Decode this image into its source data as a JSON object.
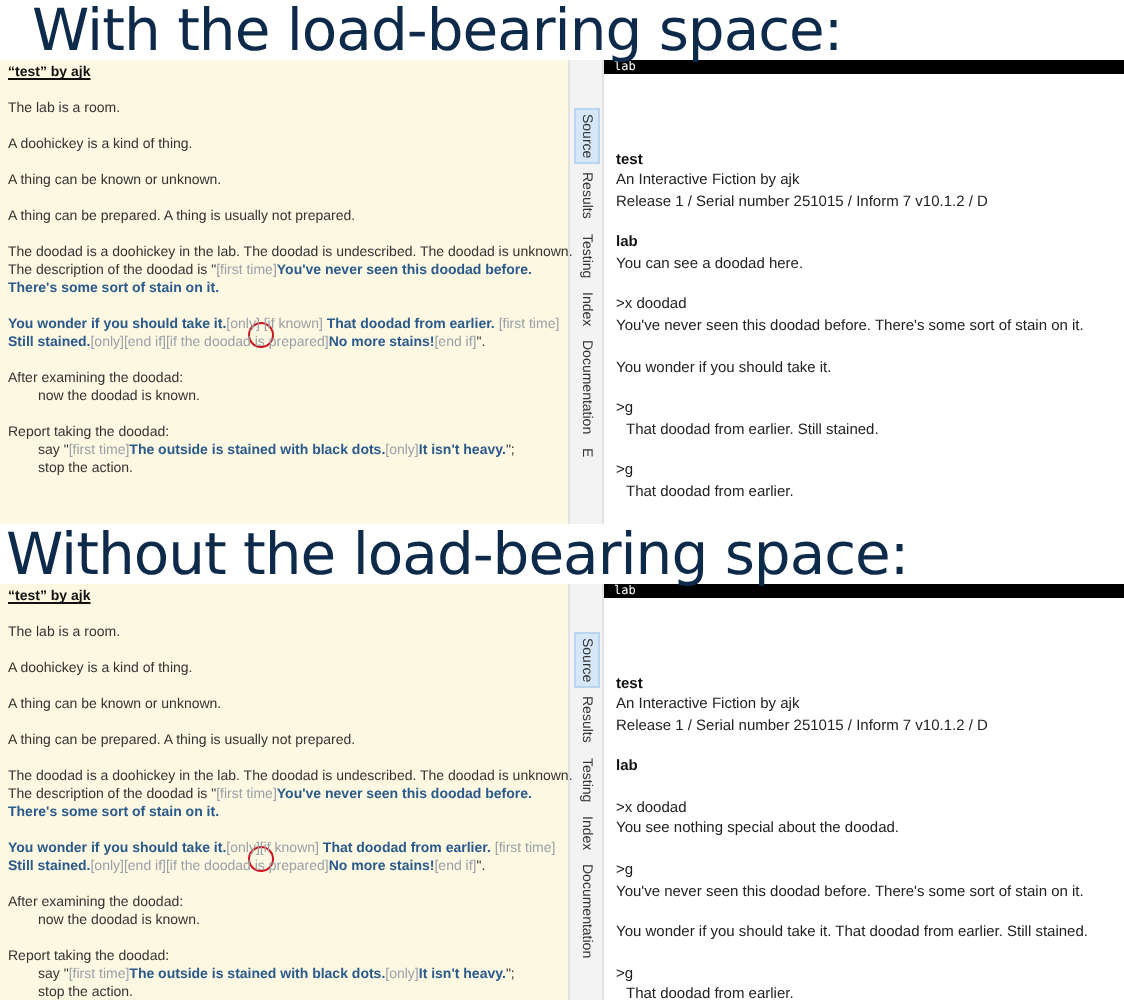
{
  "panels": [
    {
      "heading": "With the load-bearing space:",
      "source": {
        "title": "“test” by ajk",
        "paragraphs": [
          [
            {
              "segments": [
                {
                  "text": "The lab is a room.",
                  "kind": "plain"
                }
              ]
            }
          ],
          [
            {
              "segments": [
                {
                  "text": "A doohickey is a kind of thing.",
                  "kind": "plain"
                }
              ]
            }
          ],
          [
            {
              "segments": [
                {
                  "text": "A thing can be known or unknown.",
                  "kind": "plain"
                }
              ]
            }
          ],
          [
            {
              "segments": [
                {
                  "text": "A thing can be prepared. A thing is usually not prepared.",
                  "kind": "plain"
                }
              ]
            }
          ],
          [
            {
              "segments": [
                {
                  "text": "The doodad is a doohickey in the lab.  The doodad is undescribed. The doodad is unknown.",
                  "kind": "plain"
                }
              ]
            },
            {
              "segments": [
                {
                  "text": "The description of the doodad is \"",
                  "kind": "plain"
                },
                {
                  "text": "[first time]",
                  "kind": "comment"
                },
                {
                  "text": "You've never seen this doodad before.",
                  "kind": "quoted"
                }
              ]
            },
            {
              "segments": [
                {
                  "text": "There's some sort of stain on it.",
                  "kind": "quoted"
                }
              ]
            }
          ],
          [
            {
              "segments": [
                {
                  "text": "You wonder if you should take it.",
                  "kind": "quoted"
                },
                {
                  "text": "[only]",
                  "kind": "comment"
                },
                {
                  "text": " [if known]",
                  "kind": "comment",
                  "circled": true
                },
                {
                  "text": " That doodad from earlier.",
                  "kind": "quoted"
                },
                {
                  "text": " [first time]",
                  "kind": "comment"
                }
              ]
            },
            {
              "segments": [
                {
                  "text": "Still stained.",
                  "kind": "quoted"
                },
                {
                  "text": "[only][end if][if the doodad is prepared]",
                  "kind": "comment"
                },
                {
                  "text": "No more stains!",
                  "kind": "quoted"
                },
                {
                  "text": "[end if]",
                  "kind": "comment"
                },
                {
                  "text": "\".",
                  "kind": "plain"
                }
              ]
            }
          ],
          [
            {
              "segments": [
                {
                  "text": "After examining the doodad:",
                  "kind": "plain"
                }
              ],
              "children": [
                {
                  "segments": [
                    {
                      "text": "now the doodad is known.",
                      "kind": "plain"
                    }
                  ]
                }
              ]
            }
          ],
          [
            {
              "segments": [
                {
                  "text": "Report taking the doodad:",
                  "kind": "plain"
                }
              ],
              "children": [
                {
                  "segments": [
                    {
                      "text": "say \"",
                      "kind": "plain"
                    },
                    {
                      "text": "[first time]",
                      "kind": "comment"
                    },
                    {
                      "text": "The outside is stained with black dots.",
                      "kind": "quoted"
                    },
                    {
                      "text": "[only]",
                      "kind": "comment"
                    },
                    {
                      "text": "It isn't heavy.",
                      "kind": "quoted"
                    },
                    {
                      "text": "\";",
                      "kind": "plain"
                    }
                  ]
                },
                {
                  "segments": [
                    {
                      "text": "stop the action.",
                      "kind": "plain"
                    }
                  ]
                }
              ]
            }
          ]
        ]
      },
      "tabs": [
        {
          "label": "Source",
          "selected": true
        },
        {
          "label": "Results",
          "selected": false
        },
        {
          "label": "Testing",
          "selected": false
        },
        {
          "label": "Index",
          "selected": false
        },
        {
          "label": "Documentation",
          "selected": false
        },
        {
          "label": "E",
          "selected": false
        }
      ],
      "status_bar": "lab",
      "story": [
        [
          {
            "text": "test",
            "kind": "title"
          },
          {
            "text": "An Interactive Fiction by ajk",
            "kind": "plain"
          },
          {
            "text": "Release 1 / Serial number 251015 / Inform 7 v10.1.2 / D",
            "kind": "plain"
          }
        ],
        [
          {
            "text": "lab",
            "kind": "title"
          },
          {
            "text": "You can see a doodad here.",
            "kind": "plain"
          }
        ],
        [
          {
            "text": ">x doodad",
            "kind": "plain"
          },
          {
            "text": "You've never seen this doodad before. There's some sort of stain on it.",
            "kind": "plain"
          }
        ],
        [
          {
            "text": "You wonder if you should take it.",
            "kind": "plain"
          }
        ],
        [
          {
            "text": ">g",
            "kind": "plain"
          },
          {
            "text": "That doodad from earlier. Still stained.",
            "kind": "indented"
          }
        ],
        [
          {
            "text": ">g",
            "kind": "plain"
          },
          {
            "text": "That doodad from earlier.",
            "kind": "indented"
          }
        ]
      ]
    },
    {
      "heading": "Without the load-bearing space:",
      "source": {
        "title": "“test” by ajk",
        "paragraphs": [
          [
            {
              "segments": [
                {
                  "text": "The lab is a room.",
                  "kind": "plain"
                }
              ]
            }
          ],
          [
            {
              "segments": [
                {
                  "text": "A doohickey is a kind of thing.",
                  "kind": "plain"
                }
              ]
            }
          ],
          [
            {
              "segments": [
                {
                  "text": "A thing can be known or unknown.",
                  "kind": "plain"
                }
              ]
            }
          ],
          [
            {
              "segments": [
                {
                  "text": "A thing can be prepared. A thing is usually not prepared.",
                  "kind": "plain"
                }
              ]
            }
          ],
          [
            {
              "segments": [
                {
                  "text": "The doodad is a doohickey in the lab.  The doodad is undescribed. The doodad is unknown.",
                  "kind": "plain"
                }
              ]
            },
            {
              "segments": [
                {
                  "text": "The description of the doodad is \"",
                  "kind": "plain"
                },
                {
                  "text": "[first time]",
                  "kind": "comment"
                },
                {
                  "text": "You've never seen this doodad before.",
                  "kind": "quoted"
                }
              ]
            },
            {
              "segments": [
                {
                  "text": "There's some sort of stain on it.",
                  "kind": "quoted"
                }
              ]
            }
          ],
          [
            {
              "segments": [
                {
                  "text": "You wonder if you should take it.",
                  "kind": "quoted"
                },
                {
                  "text": "[only]",
                  "kind": "comment"
                },
                {
                  "text": "[if known]",
                  "kind": "comment",
                  "circled": true
                },
                {
                  "text": " That doodad from earlier.",
                  "kind": "quoted"
                },
                {
                  "text": " [first time]",
                  "kind": "comment"
                }
              ]
            },
            {
              "segments": [
                {
                  "text": "Still stained.",
                  "kind": "quoted"
                },
                {
                  "text": "[only][end if][if the doodad is prepared]",
                  "kind": "comment"
                },
                {
                  "text": "No more stains!",
                  "kind": "quoted"
                },
                {
                  "text": "[end if]",
                  "kind": "comment"
                },
                {
                  "text": "\".",
                  "kind": "plain"
                }
              ]
            }
          ],
          [
            {
              "segments": [
                {
                  "text": "After examining the doodad:",
                  "kind": "plain"
                }
              ],
              "children": [
                {
                  "segments": [
                    {
                      "text": "now the doodad is known.",
                      "kind": "plain"
                    }
                  ]
                }
              ]
            }
          ],
          [
            {
              "segments": [
                {
                  "text": "Report taking the doodad:",
                  "kind": "plain"
                }
              ],
              "children": [
                {
                  "segments": [
                    {
                      "text": "say \"",
                      "kind": "plain"
                    },
                    {
                      "text": "[first time]",
                      "kind": "comment"
                    },
                    {
                      "text": "The outside is stained with black dots.",
                      "kind": "quoted"
                    },
                    {
                      "text": "[only]",
                      "kind": "comment"
                    },
                    {
                      "text": "It isn't heavy.",
                      "kind": "quoted"
                    },
                    {
                      "text": "\";",
                      "kind": "plain"
                    }
                  ]
                },
                {
                  "segments": [
                    {
                      "text": "stop the action.",
                      "kind": "plain"
                    }
                  ]
                }
              ]
            }
          ]
        ]
      },
      "tabs": [
        {
          "label": "Source",
          "selected": true
        },
        {
          "label": "Results",
          "selected": false
        },
        {
          "label": "Testing",
          "selected": false
        },
        {
          "label": "Index",
          "selected": false
        },
        {
          "label": "Documentation",
          "selected": false
        }
      ],
      "status_bar": "lab",
      "story": [
        [
          {
            "text": "test",
            "kind": "title"
          },
          {
            "text": "An Interactive Fiction by ajk",
            "kind": "plain"
          },
          {
            "text": "Release 1 / Serial number 251015 / Inform 7 v10.1.2 / D",
            "kind": "plain"
          }
        ],
        [
          {
            "text": "lab",
            "kind": "title"
          }
        ],
        [
          {
            "text": ">x doodad",
            "kind": "plain"
          },
          {
            "text": "You see nothing special about the doodad.",
            "kind": "plain"
          }
        ],
        [
          {
            "text": ">g",
            "kind": "plain"
          },
          {
            "text": "You've never seen this doodad before. There's some sort of stain on it.",
            "kind": "plain"
          }
        ],
        [
          {
            "text": "You wonder if you should take it. That doodad from earlier. Still stained.",
            "kind": "plain"
          }
        ],
        [
          {
            "text": ">g",
            "kind": "plain"
          },
          {
            "text": "That doodad from earlier.",
            "kind": "indented"
          }
        ]
      ]
    }
  ]
}
